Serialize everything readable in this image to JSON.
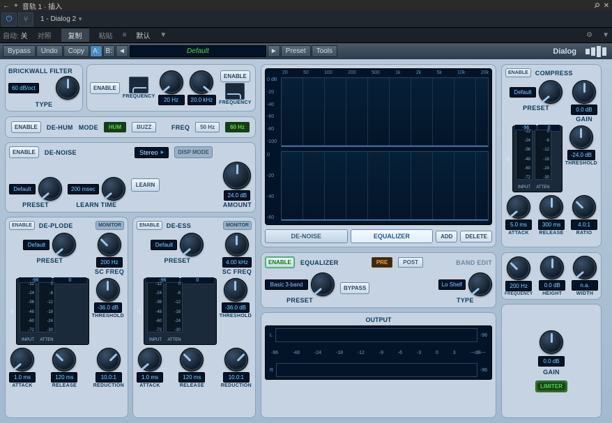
{
  "host": {
    "title_prefix": "+",
    "title": "音轨 1 · 插入",
    "preset": "1 - Dialog 2",
    "row3": {
      "auto": "自动:",
      "off": "关",
      "compare": "对照",
      "copy": "复制",
      "paste": "粘贴",
      "default": "默认"
    }
  },
  "topbar": {
    "bypass": "Bypass",
    "undo": "Undo",
    "copy": "Copy",
    "a": "A:",
    "b": "B:",
    "preset_name": "Default",
    "preset": "Preset",
    "tools": "Tools",
    "brand": "Dialog"
  },
  "brickwall": {
    "title": "BRICKWALL FILTER",
    "enable": "ENABLE",
    "type_val": "60 dB/oct",
    "type": "TYPE",
    "frequency": "FREQUENCY",
    "hp_val": "20 Hz",
    "lp_val": "20.0 kHz"
  },
  "dehum": {
    "enable": "ENABLE",
    "title": "DE-HUM",
    "mode": "MODE",
    "hum": "HUM",
    "buzz": "BUZZ",
    "freq": "FREQ",
    "hz50": "50 Hz",
    "hz60": "60 Hz"
  },
  "denoise": {
    "enable": "ENABLE",
    "title": "DE-NOISE",
    "stereo": "Stereo",
    "disp": "DISP MODE",
    "preset_val": "Default",
    "preset": "PRESET",
    "learn_val": "200 msec",
    "learn": "LEARN TIME",
    "learn_btn": "LEARN",
    "amount_val": "24.0 dB",
    "amount": "AMOUNT"
  },
  "deplode": {
    "enable": "ENABLE",
    "title": "DE-PLODE",
    "monitor": "MONITOR",
    "preset_val": "Default",
    "preset": "PRESET",
    "scfreq_val": "200 Hz",
    "scfreq": "SC FREQ",
    "meter_in": "-96",
    "meter_att": "0",
    "in_ticks": [
      "-12",
      "-24",
      "-36",
      "-48",
      "-60",
      "-72"
    ],
    "att_ticks": [
      "0",
      "-6",
      "-12",
      "-18",
      "-24",
      "-30"
    ],
    "in": "INPUT",
    "att": "ATTEN",
    "thresh_val": "-36.0 dB",
    "thresh": "THRESHOLD",
    "attack_val": "1.0 ms",
    "attack": "ATTACK",
    "release_val": "120 ms",
    "release": "RELEASE",
    "reduction_val": "10.0:1",
    "reduction": "REDUCTION"
  },
  "deess": {
    "enable": "ENABLE",
    "title": "DE-ESS",
    "monitor": "MONITOR",
    "preset_val": "Default",
    "preset": "PRESET",
    "scfreq_val": "4.00 kHz",
    "scfreq": "SC FREQ",
    "meter_in": "-96",
    "meter_att": "0",
    "in_ticks": [
      "-12",
      "-24",
      "-36",
      "-48",
      "-60",
      "-72"
    ],
    "att_ticks": [
      "0",
      "-6",
      "-12",
      "-18",
      "-24",
      "-30"
    ],
    "in": "INPUT",
    "att": "ATTEN",
    "thresh_val": "-36.0 dB",
    "thresh": "THRESHOLD",
    "attack_val": "1.0 ms",
    "attack": "ATTACK",
    "release_val": "120 ms",
    "release": "RELEASE",
    "reduction_val": "10.0:1",
    "reduction": "REDUCTION"
  },
  "graph": {
    "xlabels": [
      "20",
      "50",
      "100",
      "200",
      "500",
      "1k",
      "2k",
      "5k",
      "10k",
      "20k"
    ],
    "ylabels": [
      "0 dB",
      "-20",
      "-40",
      "-60",
      "-80",
      "-100"
    ],
    "ylabels2": [
      "0",
      "-20",
      "-40",
      "-60"
    ],
    "tab_denoise": "DE-NOISE",
    "tab_eq": "EQUALIZER",
    "add": "ADD",
    "delete": "DELETE"
  },
  "eq": {
    "enable": "ENABLE",
    "title": "EQUALIZER",
    "pre": "PRE",
    "post": "POST",
    "band": "BAND EDIT",
    "preset_val": "Basic 3-band",
    "preset": "PRESET",
    "bypass": "BYPASS",
    "type_val": "Lo Shelf",
    "type": "TYPE",
    "freq_val": "200 Hz",
    "freq": "FREQUENCY",
    "height_val": "0.0 dB",
    "height": "HEIGHT",
    "width_val": "n.a.",
    "width": "WIDTH"
  },
  "compress": {
    "enable": "ENABLE",
    "title": "COMPRESS",
    "preset_val": "Default",
    "preset": "PRESET",
    "gain_val": "0.0 dB",
    "gain": "GAIN",
    "meter_in": "-96",
    "meter_att": "0",
    "in_ticks": [
      "-12",
      "-24",
      "-36",
      "-48",
      "-60",
      "-72"
    ],
    "att_ticks": [
      "0",
      "-6",
      "-12",
      "-18",
      "-24",
      "-30"
    ],
    "in": "INPUT",
    "att": "ATTEN",
    "thresh_val": "-24.0 dB",
    "thresh": "THRESHOLD",
    "attack_val": "5.0 ms",
    "attack": "ATTACK",
    "release_val": "300 ms",
    "release": "RELEASE",
    "ratio_val": "4.0:1",
    "ratio": "RATIO"
  },
  "output": {
    "title": "OUTPUT",
    "l": "L",
    "r": "R",
    "peak": "-96",
    "scale": [
      "-96",
      "-48",
      "-24",
      "-18",
      "-12",
      "-9",
      "-6",
      "-3",
      "0",
      "3"
    ],
    "db": "---dB---",
    "gain_val": "0.0 dB",
    "gain": "GAIN",
    "limiter": "LIMITER"
  }
}
